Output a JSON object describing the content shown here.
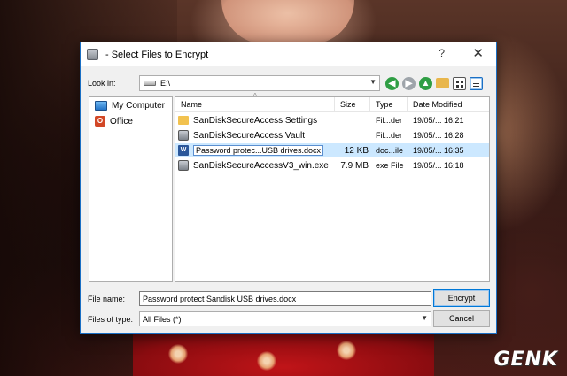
{
  "dialog": {
    "title": "- Select Files to Encrypt",
    "help_label": "?",
    "close_label": "✕"
  },
  "lookin": {
    "label": "Look in:",
    "value": "E:\\"
  },
  "places": [
    {
      "label": "My Computer",
      "icon": "computer-icon"
    },
    {
      "label": "Office",
      "icon": "office-icon"
    }
  ],
  "columns": {
    "name": "Name",
    "size": "Size",
    "type": "Type",
    "date": "Date Modified"
  },
  "files": [
    {
      "name": "SanDiskSecureAccess Settings",
      "size": "",
      "type": "Fil...der",
      "date": "19/05/... 16:21",
      "icon": "folder-icon"
    },
    {
      "name": "SanDiskSecureAccess Vault",
      "size": "",
      "type": "Fil...der",
      "date": "19/05/... 16:28",
      "icon": "vault-icon"
    },
    {
      "name": "Password protec...USB drives.docx",
      "size": "12 KB",
      "type": "doc...ile",
      "date": "19/05/... 16:35",
      "icon": "word-doc-icon"
    },
    {
      "name": "SanDiskSecureAccessV3_win.exe",
      "size": "7.9 MB",
      "type": "exe File",
      "date": "19/05/... 16:18",
      "icon": "exe-icon"
    }
  ],
  "filename": {
    "label": "File name:",
    "value": "Password protect Sandisk USB drives.docx"
  },
  "filetype": {
    "label": "Files of type:",
    "value": "All Files (*)"
  },
  "buttons": {
    "encrypt": "Encrypt",
    "cancel": "Cancel"
  },
  "watermark": "GENK",
  "colors": {
    "accent": "#0078d7",
    "selection": "#cce8ff"
  }
}
